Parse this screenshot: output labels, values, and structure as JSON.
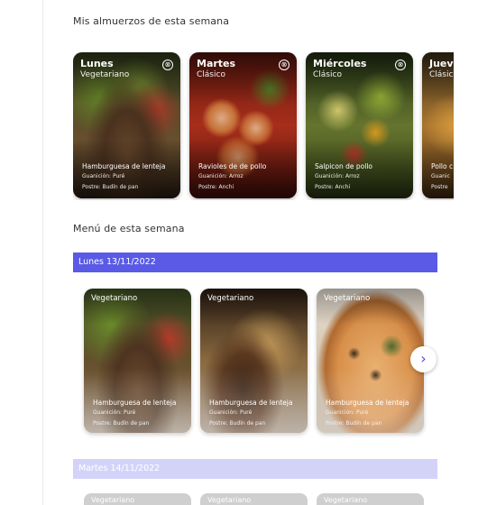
{
  "weekly": {
    "title": "Mis almuerzos de esta semana",
    "cards": [
      {
        "day": "Lunes",
        "type": "Vegetariano",
        "dish": "Hamburguesa de lenteja",
        "side": "Guanición:  Puré",
        "dessert": "Postre:  Budín de pan",
        "close": "⊗"
      },
      {
        "day": "Martes",
        "type": "Clásico",
        "dish": "Ravioles de de pollo",
        "side": "Guanición:  Arroz",
        "dessert": "Postre:  Anchi",
        "close": "⊗"
      },
      {
        "day": "Miércoles",
        "type": "Clásico",
        "dish": "Salpicon de pollo",
        "side": "Guanición:  Arroz",
        "dessert": "Postre:  Anchi",
        "close": "⊗"
      },
      {
        "day": "Jueves",
        "type": "Clásico",
        "dish": "Pollo c",
        "side": "Guanic",
        "dessert": "Postre",
        "close": "⊗"
      }
    ]
  },
  "menu": {
    "title": "Menú de esta semana",
    "days": [
      {
        "label": "Lunes  13/11/2022"
      },
      {
        "label": "Martes  14/11/2022"
      }
    ],
    "cards": [
      {
        "type": "Vegetariano",
        "dish": "Hamburguesa de lenteja",
        "side": "Guanición:  Puré",
        "dessert": "Postre:  Budín de pan"
      },
      {
        "type": "Vegetariano",
        "dish": "Hamburguesa de lenteja",
        "side": "Guanición:  Puré",
        "dessert": "Postre:  Budín de pan"
      },
      {
        "type": "Vegetariano",
        "dish": "Hamburguesa de lenteja",
        "side": "Guanición:  Puré",
        "dessert": "Postre:  Budín de pan"
      }
    ],
    "faded": [
      "Vegetariano",
      "Vegetariano",
      "Vegetariano"
    ],
    "next": "›"
  },
  "colors": {
    "accent": "#5a5ae6",
    "accent_light": "#d3d3fa"
  }
}
